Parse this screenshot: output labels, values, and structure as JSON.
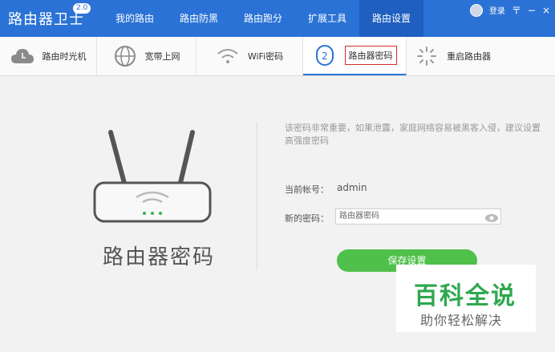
{
  "app": {
    "title": "路由器卫士",
    "version": "2.0"
  },
  "nav": [
    {
      "label": "我的路由"
    },
    {
      "label": "路由防黑"
    },
    {
      "label": "路由跑分"
    },
    {
      "label": "扩展工具"
    },
    {
      "label": "路由设置"
    }
  ],
  "top_right": {
    "login": "登录",
    "menu": "〒",
    "minimize": "−",
    "close": "×"
  },
  "subnav": [
    {
      "label": "路由时光机",
      "icon": "cloud-icon"
    },
    {
      "label": "宽带上网",
      "icon": "globe-icon"
    },
    {
      "label": "WiFi密码",
      "icon": "wifi-icon"
    },
    {
      "label": "路由器密码",
      "icon": "password-icon"
    },
    {
      "label": "重启路由器",
      "icon": "restart-icon"
    }
  ],
  "main": {
    "title": "路由器密码",
    "notice": "该密码非常重要，如果泄露，家庭网络容易被黑客入侵，建议设置高强度密码",
    "account_label": "当前帐号：",
    "account_value": "admin",
    "password_label": "新的密码：",
    "password_placeholder": "路由器密码",
    "save_label": "保存设置"
  },
  "watermark": {
    "main": "百科全说",
    "sub": "助你轻松解决"
  },
  "colors": {
    "topbar": "#2b72d6",
    "save_button": "#4fc04a",
    "highlight_border": "#d42d2d"
  }
}
